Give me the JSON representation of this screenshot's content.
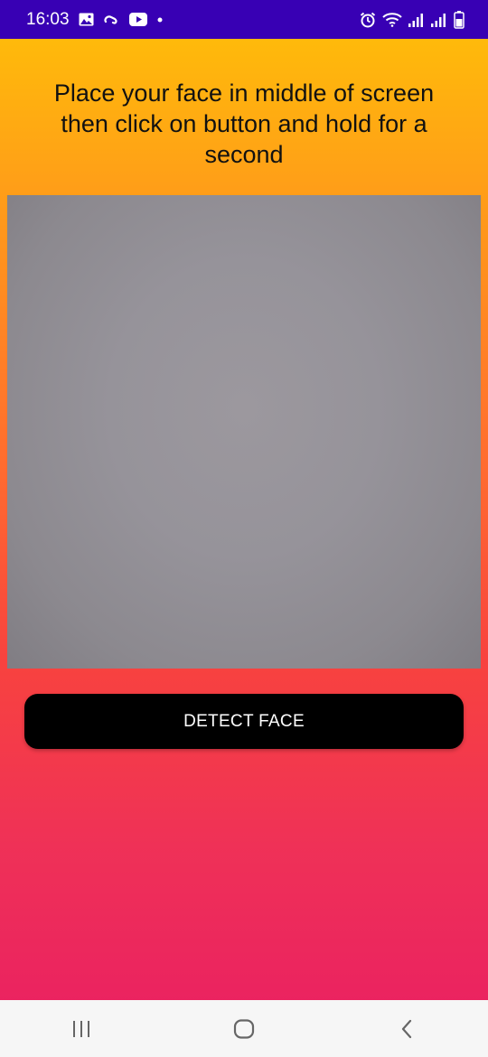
{
  "status_bar": {
    "time": "16:03",
    "notification_icons": [
      "gallery-icon",
      "link-icon",
      "youtube-icon",
      "dot-icon"
    ],
    "system_icons": [
      "alarm-icon",
      "wifi-icon",
      "signal-icon",
      "signal-icon",
      "battery-icon"
    ],
    "background_color": "#3800b4"
  },
  "main": {
    "instruction": "Place your face in middle of screen then click on button and hold for a second",
    "detect_button_label": "DETECT FACE",
    "gradient_colors": [
      "#ffc107",
      "#ff6a30",
      "#e91e63"
    ]
  },
  "nav_bar": {
    "buttons": [
      "recent-apps-icon",
      "home-icon",
      "back-icon"
    ]
  }
}
